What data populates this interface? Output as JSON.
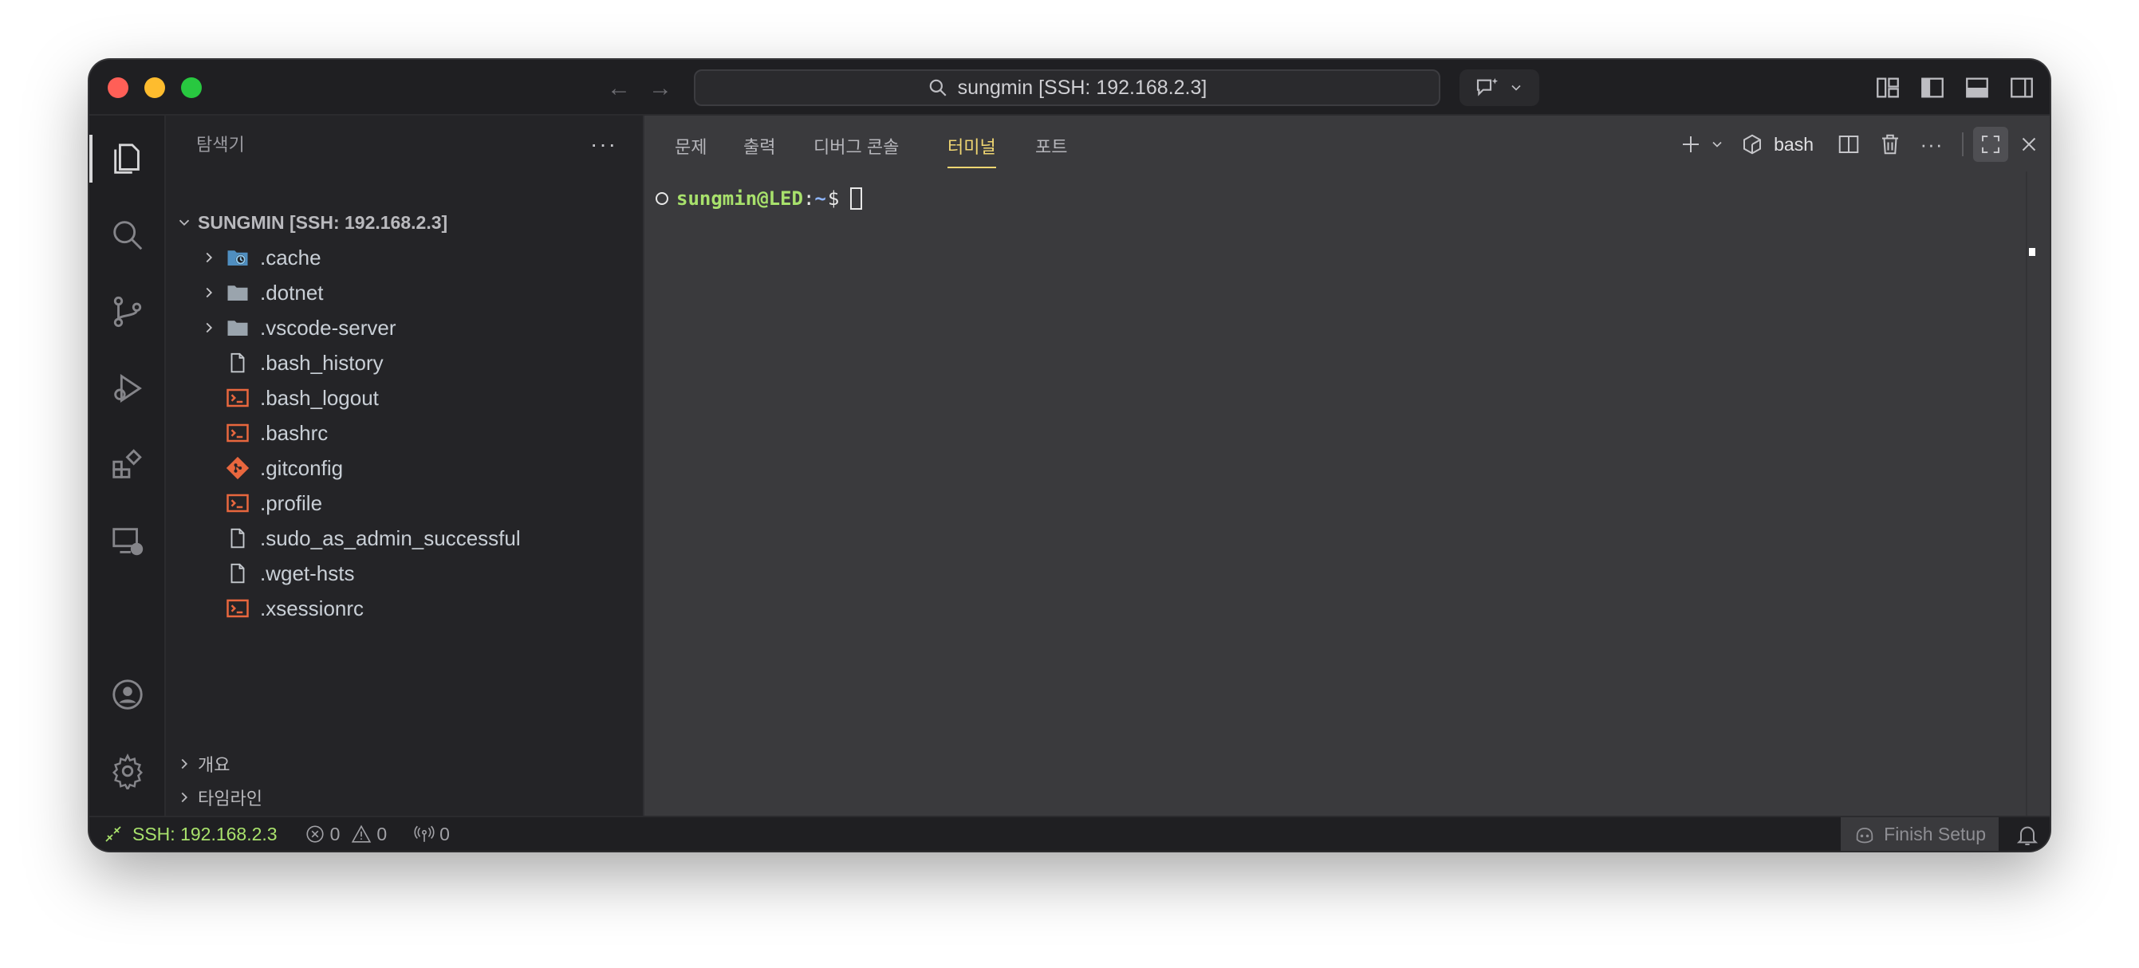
{
  "titlebar": {
    "command_center": "sungmin [SSH: 192.168.2.3]"
  },
  "sidebar": {
    "header": "탐색기",
    "root_label": "SUNGMIN [SSH: 192.168.2.3]",
    "items": [
      {
        "label": ".cache",
        "type": "folder-special",
        "expandable": true
      },
      {
        "label": ".dotnet",
        "type": "folder",
        "expandable": true
      },
      {
        "label": ".vscode-server",
        "type": "folder",
        "expandable": true
      },
      {
        "label": ".bash_history",
        "type": "file",
        "expandable": false
      },
      {
        "label": ".bash_logout",
        "type": "shell",
        "expandable": false
      },
      {
        "label": ".bashrc",
        "type": "shell",
        "expandable": false
      },
      {
        "label": ".gitconfig",
        "type": "git",
        "expandable": false
      },
      {
        "label": ".profile",
        "type": "shell",
        "expandable": false
      },
      {
        "label": ".sudo_as_admin_successful",
        "type": "file",
        "expandable": false
      },
      {
        "label": ".wget-hsts",
        "type": "file",
        "expandable": false
      },
      {
        "label": ".xsessionrc",
        "type": "shell",
        "expandable": false
      }
    ],
    "outline_label": "개요",
    "timeline_label": "타임라인"
  },
  "panel": {
    "tabs": [
      "문제",
      "출력",
      "디버그 콘솔",
      "터미널",
      "포트"
    ],
    "active_tab": "터미널",
    "terminal_name": "bash"
  },
  "terminal": {
    "user_host": "sungmin@LED",
    "colon": ":",
    "path": "~",
    "dollar": "$"
  },
  "statusbar": {
    "remote": "SSH: 192.168.2.3",
    "errors": "0",
    "warnings": "0",
    "ports": "0",
    "finish_setup": "Finish Setup"
  },
  "colors": {
    "accent_tab": "#f0d672",
    "prompt_user": "#a8e16c",
    "prompt_path": "#8fb6ff",
    "shell_icon": "#e8673e",
    "folder_icon": "#9aa4ad"
  }
}
